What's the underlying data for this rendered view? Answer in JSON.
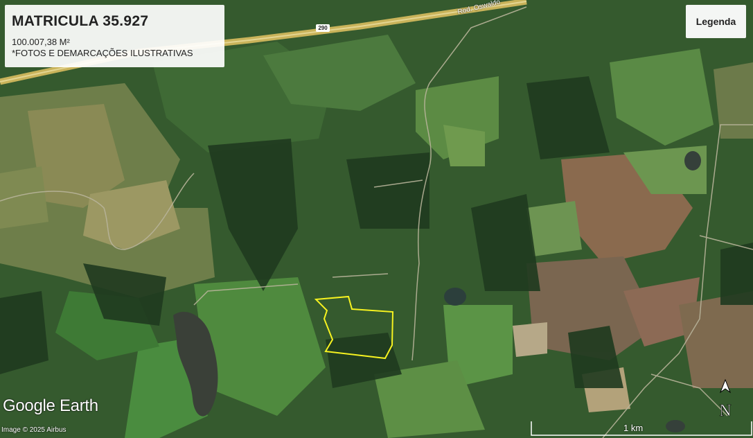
{
  "info": {
    "title": "MATRICULA 35.927",
    "area": "100.007,38 M²",
    "note": "*FOTOS E DEMARCAÇÕES ILUSTRATIVAS"
  },
  "legend_button": {
    "label": "Legenda"
  },
  "road": {
    "label": "Rod. Oswaldo",
    "shield": "290"
  },
  "branding": {
    "name": "Google Earth",
    "credit": "Image © 2025 Airbus"
  },
  "scale": {
    "label": "1 km"
  },
  "compass": {
    "letter": "N",
    "icon": "north-arrow-icon"
  },
  "colors": {
    "boundary": "#f7f320",
    "highway": "#c9b35a"
  }
}
